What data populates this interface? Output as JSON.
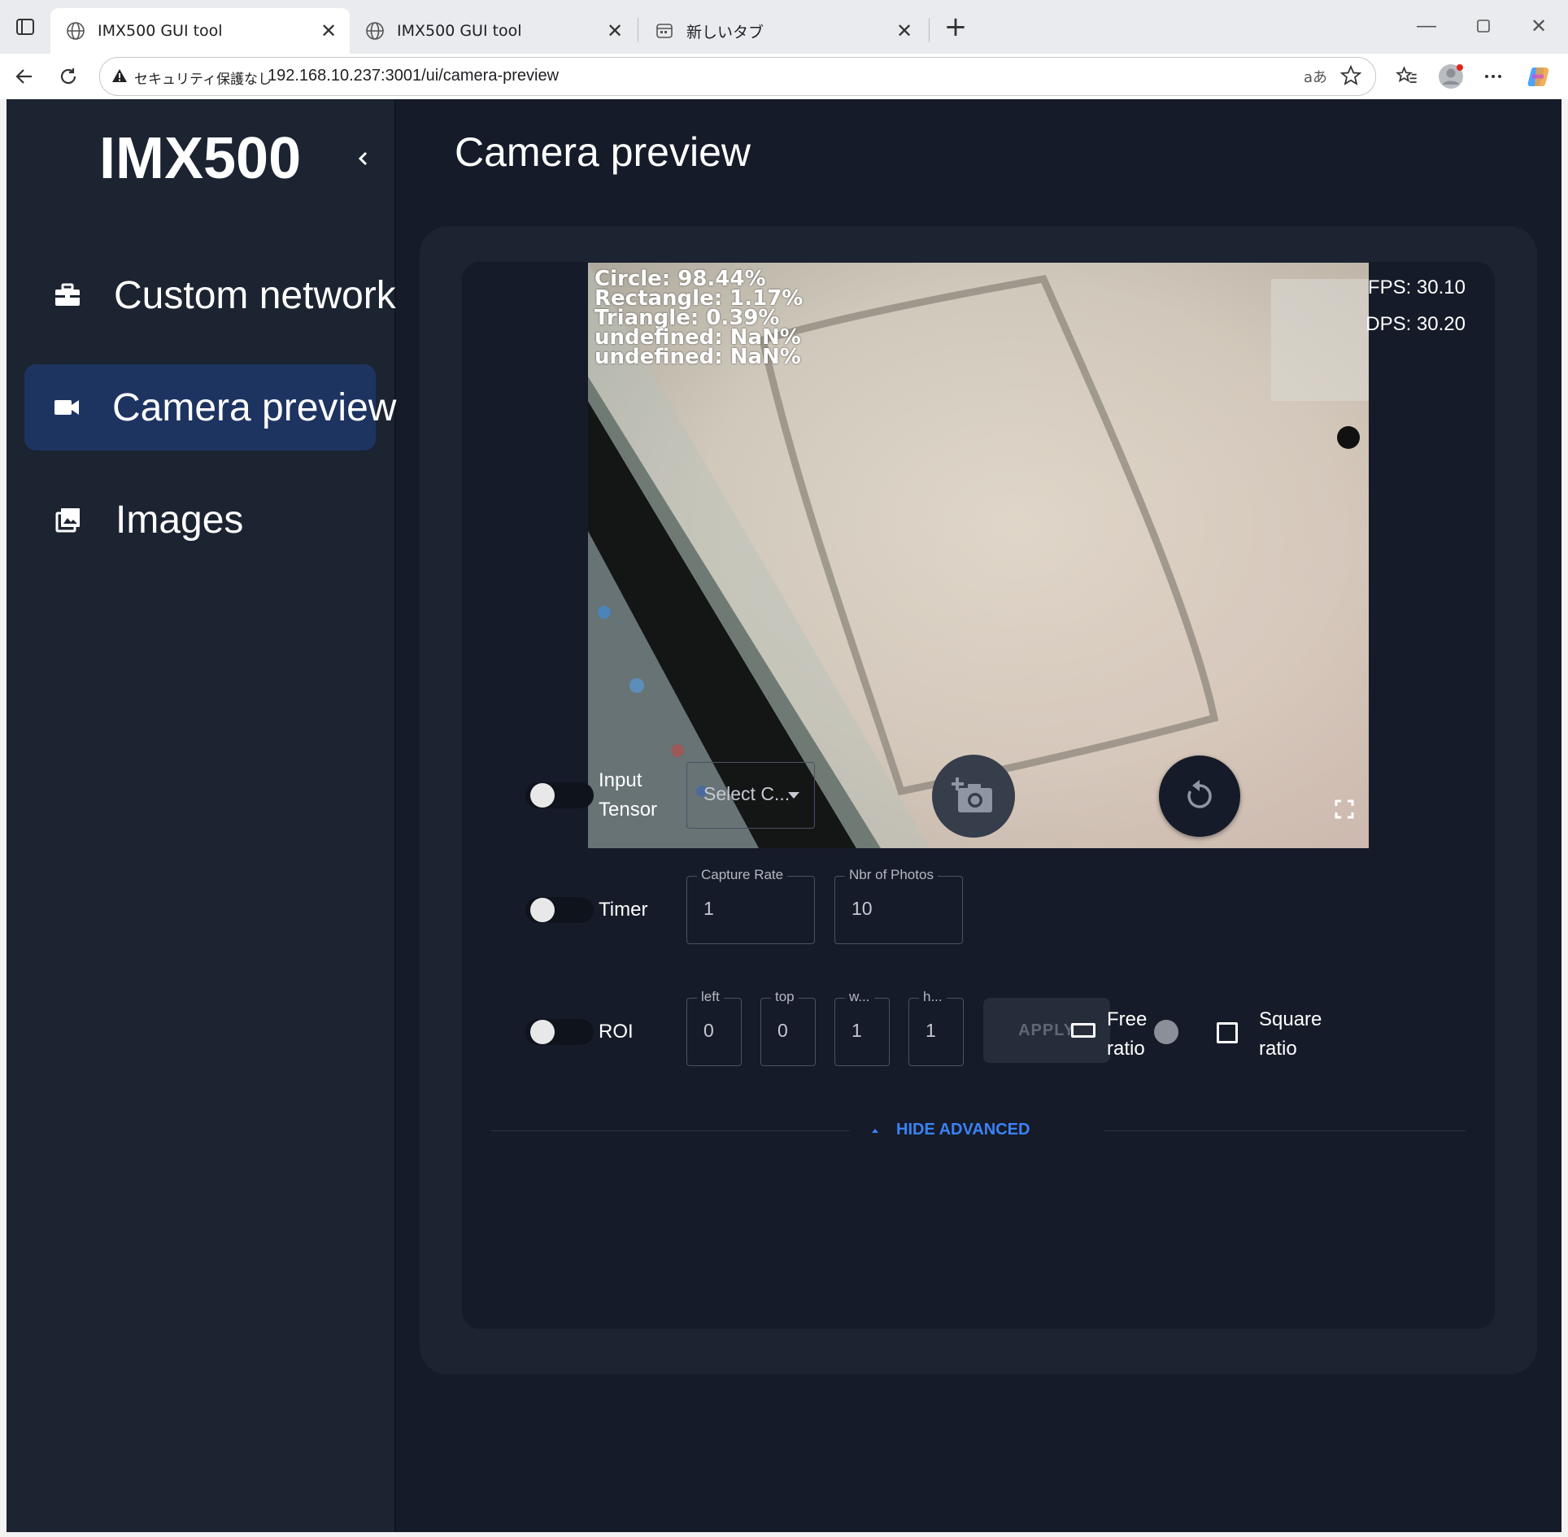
{
  "browser": {
    "tabs": [
      {
        "label": "IMX500 GUI tool",
        "active": true
      },
      {
        "label": "IMX500 GUI tool",
        "active": false
      },
      {
        "label": "新しいタブ",
        "active": false
      }
    ],
    "security_label": "セキュリティ保護なし",
    "url": "192.168.10.237:3001/ui/camera-preview",
    "translate_glyph": "aあ"
  },
  "sidebar": {
    "brand": "IMX500",
    "items": [
      {
        "label": "Custom network",
        "icon": "briefcase-icon",
        "active": false
      },
      {
        "label": "Camera preview",
        "icon": "videocam-icon",
        "active": true
      },
      {
        "label": "Images",
        "icon": "photo-library-icon",
        "active": false
      }
    ]
  },
  "main": {
    "title": "Camera preview"
  },
  "preview": {
    "detections": [
      "Circle: 98.44%",
      "Rectangle: 1.17%",
      "Triangle: 0.39%",
      "undefined: NaN%",
      "undefined: NaN%"
    ],
    "fps": "FPS: 30.10",
    "dps": "DPS: 30.20"
  },
  "controls": {
    "input_tensor": {
      "label_line1": "Input",
      "label_line2": "Tensor",
      "enabled": false
    },
    "select_placeholder": "Select C...",
    "timer": {
      "label": "Timer",
      "enabled": false
    },
    "capture_rate": {
      "label": "Capture Rate",
      "value": "1"
    },
    "nbr_photos": {
      "label": "Nbr of Photos",
      "value": "10"
    },
    "roi": {
      "label": "ROI",
      "enabled": false
    },
    "roi_fields": [
      {
        "label": "left",
        "value": "0"
      },
      {
        "label": "top",
        "value": "0"
      },
      {
        "label": "w...",
        "value": "1"
      },
      {
        "label": "h...",
        "value": "1"
      }
    ],
    "apply_label": "APPLY",
    "free_ratio": {
      "line1": "Free",
      "line2": "ratio"
    },
    "square_ratio": {
      "line1": "Square",
      "line2": "ratio",
      "checked": false
    },
    "hide_advanced": "HIDE ADVANCED"
  },
  "colors": {
    "background": "#151b28",
    "sidebar": "#1c2331",
    "active_nav": "#1d3461",
    "accent": "#3b82f6"
  }
}
